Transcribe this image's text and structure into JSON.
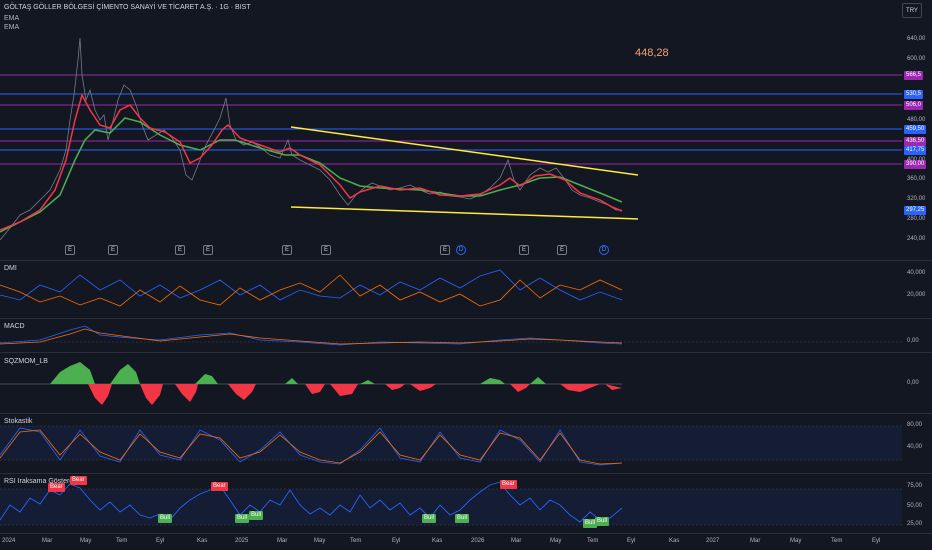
{
  "header": {
    "title": "GÖLTAŞ GÖLLER BÖLGESİ ÇİMENTO SANAYİ VE TİCARET A.Ş. · 1G · BIST",
    "legend": [
      "EMA",
      "EMA"
    ],
    "currency_button": "TRY",
    "big_price": "448,28"
  },
  "price_axis": [
    "640,00",
    "600,00",
    "480,00",
    "400,00",
    "360,00",
    "320,00",
    "280,00",
    "240,00"
  ],
  "price_labels": [
    {
      "text": "566,5",
      "color": "#9c27b0"
    },
    {
      "text": "530,5",
      "color": "#2962ff"
    },
    {
      "text": "506,0",
      "color": "#9c27b0"
    },
    {
      "text": "459,50",
      "color": "#2962ff"
    },
    {
      "text": "436,50",
      "color": "#9c27b0"
    },
    {
      "text": "417,75",
      "color": "#2962ff"
    },
    {
      "text": "390,00",
      "color": "#9c27b0"
    },
    {
      "text": "297,25",
      "color": "#2962ff"
    }
  ],
  "event_badges": {
    "earnings": "E",
    "dividend": "D"
  },
  "panes": {
    "dmi": {
      "name": "DMI",
      "axis": [
        "40,000",
        "20,000"
      ]
    },
    "macd": {
      "name": "MACD",
      "axis": [
        "0,00"
      ]
    },
    "sqzmom": {
      "name": "SQZMOM_LB",
      "axis": [
        "0,00"
      ]
    },
    "stoch": {
      "name": "Stokastik",
      "axis": [
        "80,00",
        "40,00"
      ]
    },
    "rsi": {
      "name": "RSI Iraksama Göstergesi",
      "axis": [
        "75,00",
        "50,00",
        "25,00"
      ]
    }
  },
  "rsi_tags": {
    "bull": "Bull",
    "bear": "Bear"
  },
  "time_axis": [
    "2024",
    "Mar",
    "May",
    "Tem",
    "Eyl",
    "Kas",
    "2025",
    "Mar",
    "May",
    "Tem",
    "Eyl",
    "Kas",
    "2026",
    "Mar",
    "May",
    "Tem",
    "Eyl",
    "Kas",
    "2027",
    "Mar",
    "May",
    "Tem",
    "Eyl"
  ]
}
